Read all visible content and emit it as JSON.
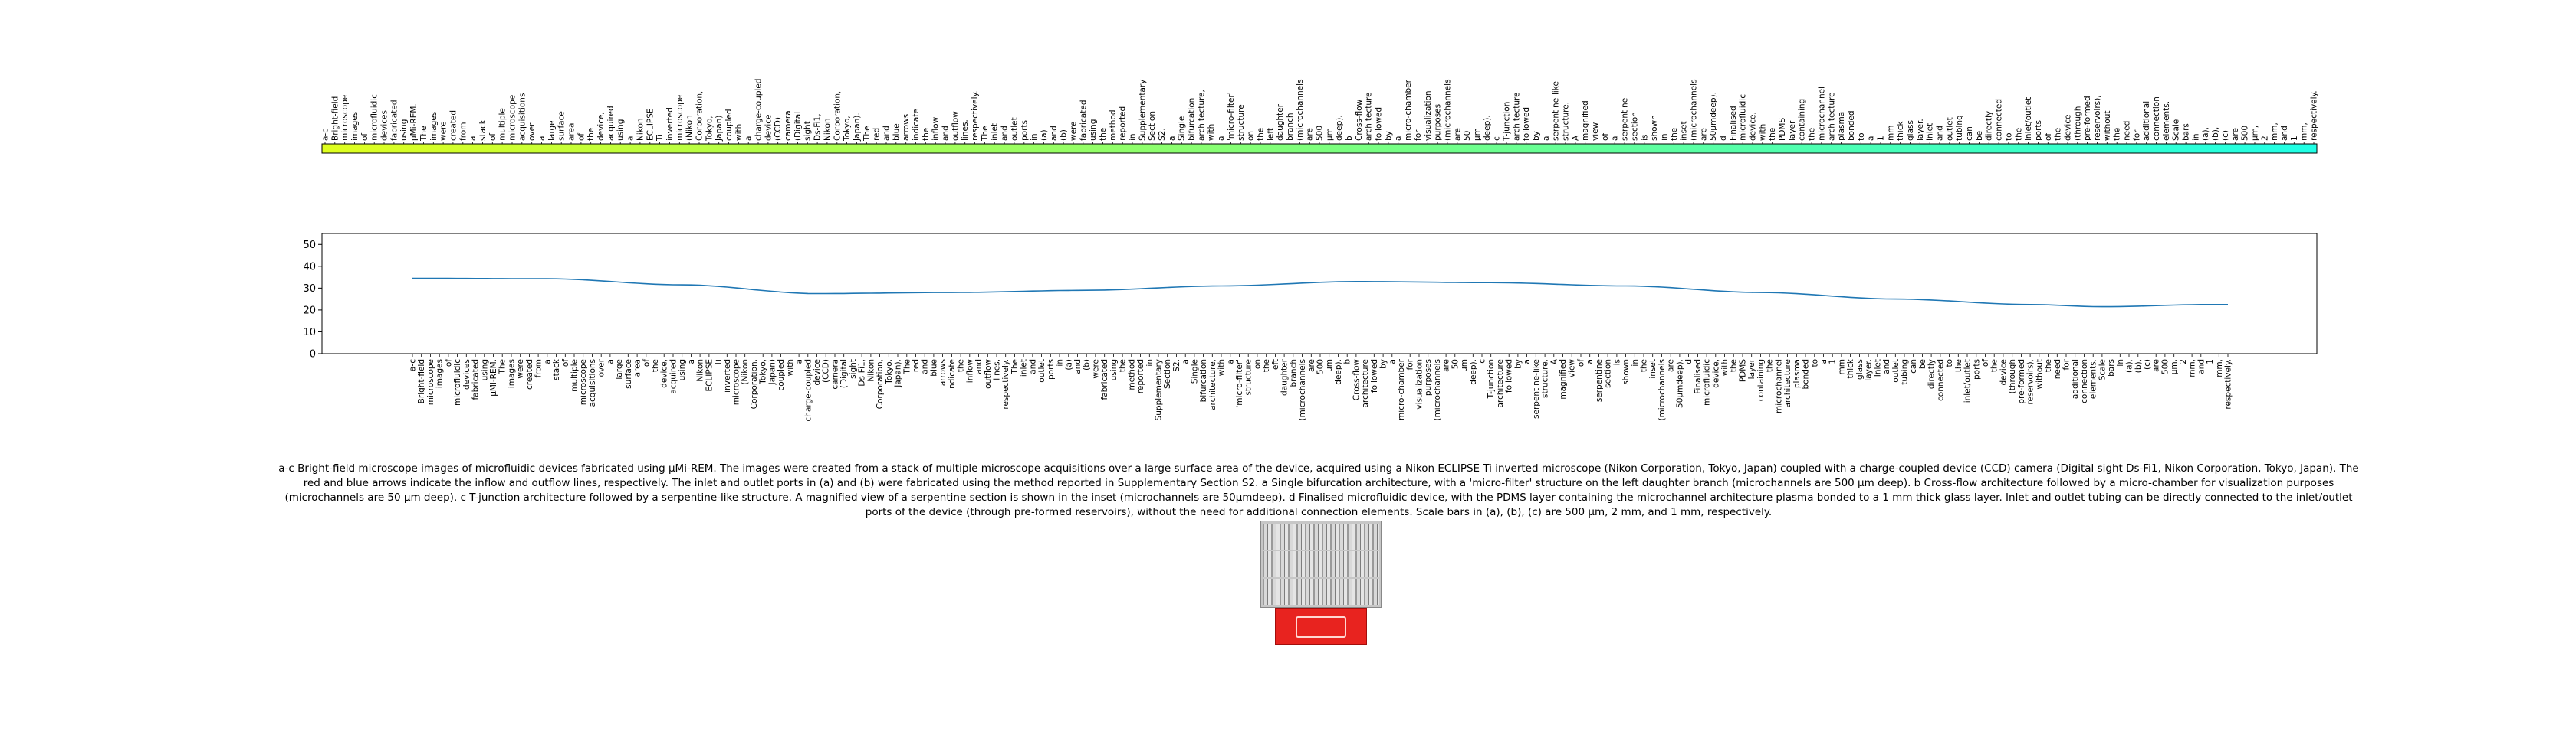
{
  "caption": "a-c Bright-field microscope images of microfluidic devices fabricated using µMi-REM. The images were created from a stack of multiple microscope acquisitions over a large surface area of the device, acquired using a Nikon ECLIPSE Ti inverted microscope (Nikon Corporation, Tokyo, Japan) coupled with a charge-coupled device (CCD) camera (Digital sight Ds-Fi1, Nikon Corporation, Tokyo, Japan). The red and blue arrows indicate the inflow and outflow lines, respectively. The inlet and outlet ports in (a) and (b) were fabricated using the method reported in Supplementary Section S2. a Single bifurcation architecture, with a 'micro-filter' structure on the left daughter branch (microchannels are 500 µm deep). b Cross-flow architecture followed by a micro-chamber for visualization purposes (microchannels are 50 µm deep). c T-junction architecture followed by a serpentine-like structure. A magnified view of a serpentine section is shown in the inset (microchannels are 50µmdeep). d Finalised microfluidic device, with the PDMS layer containing the microchannel architecture plasma bonded to a 1 mm thick glass layer. Inlet and outlet tubing can be directly connected to the inlet/outlet ports of the device (through pre-formed reservoirs), without the need for additional connection elements. Scale bars in (a), (b), (c) are 500 µm, 2 mm, and 1 mm, respectively.",
  "chart_data": {
    "type": "line",
    "x": [
      "a-c",
      "Bright-field",
      "microscope",
      "images",
      "of",
      "microfluidic",
      "devices",
      "fabricated",
      "using",
      "µMi-REM.",
      "The",
      "images",
      "were",
      "created",
      "from",
      "a",
      "stack",
      "of",
      "multiple",
      "microscope",
      "acquisitions",
      "over",
      "a",
      "large",
      "surface",
      "area",
      "of",
      "the",
      "device,",
      "acquired",
      "using",
      "a",
      "Nikon",
      "ECLIPSE",
      "Ti",
      "inverted",
      "microscope",
      "(Nikon",
      "Corporation,",
      "Tokyo,",
      "Japan)",
      "coupled",
      "with",
      "a",
      "charge-coupled",
      "device",
      "(CCD)",
      "camera",
      "(Digital",
      "sight",
      "Ds-Fi1,",
      "Nikon",
      "Corporation,",
      "Tokyo,",
      "Japan).",
      "The",
      "red",
      "and",
      "blue",
      "arrows",
      "indicate",
      "the",
      "inflow",
      "and",
      "outflow",
      "lines,",
      "respectively.",
      "The",
      "inlet",
      "and",
      "outlet",
      "ports",
      "in",
      "(a)",
      "and",
      "(b)",
      "were",
      "fabricated",
      "using",
      "the",
      "method",
      "reported",
      "in",
      "Supplementary",
      "Section",
      "S2.",
      "a",
      "Single",
      "bifurcation",
      "architecture,",
      "with",
      "a",
      "'micro-filter'",
      "structure",
      "on",
      "the",
      "left",
      "daughter",
      "branch",
      "(microchannels",
      "are",
      "500",
      "µm",
      "deep).",
      "b",
      "Cross-flow",
      "architecture",
      "followed",
      "by",
      "a",
      "micro-chamber",
      "for",
      "visualization",
      "purposes",
      "(microchannels",
      "are",
      "50",
      "µm",
      "deep).",
      "c",
      "T-junction",
      "architecture",
      "followed",
      "by",
      "a",
      "serpentine-like",
      "structure.",
      "A",
      "magnified",
      "view",
      "of",
      "a",
      "serpentine",
      "section",
      "is",
      "shown",
      "in",
      "the",
      "inset",
      "(microchannels",
      "are",
      "50µmdeep).",
      "d",
      "Finalised",
      "microfluidic",
      "device,",
      "with",
      "the",
      "PDMS",
      "layer",
      "containing",
      "the",
      "microchannel",
      "architecture",
      "plasma",
      "bonded",
      "to",
      "a",
      "1",
      "mm",
      "thick",
      "glass",
      "layer.",
      "Inlet",
      "and",
      "outlet",
      "tubing",
      "can",
      "be",
      "directly",
      "connected",
      "to",
      "the",
      "inlet/outlet",
      "ports",
      "of",
      "the",
      "device",
      "(through",
      "pre-formed",
      "reservoirs),",
      "without",
      "the",
      "need",
      "for",
      "additional",
      "connection",
      "elements.",
      "Scale",
      "bars",
      "in",
      "(a),",
      "(b),",
      "(c)",
      "are",
      "500",
      "µm,",
      "2",
      "mm,",
      "and",
      "1",
      "mm,",
      "respectively."
    ],
    "keypoints": [
      [
        0,
        34.5
      ],
      [
        15,
        34.3
      ],
      [
        30,
        31.5
      ],
      [
        45,
        27.5
      ],
      [
        60,
        28.0
      ],
      [
        75,
        29.0
      ],
      [
        90,
        31.0
      ],
      [
        105,
        33.0
      ],
      [
        120,
        32.5
      ],
      [
        135,
        31.0
      ],
      [
        150,
        28.0
      ],
      [
        165,
        25.0
      ],
      [
        180,
        22.5
      ],
      [
        188,
        21.5
      ],
      [
        200,
        22.5
      ]
    ],
    "ylim": [
      0,
      55
    ],
    "yticks": [
      0,
      10,
      20,
      30,
      40,
      50
    ],
    "line_color": "#1f77b4",
    "colorbar": {
      "from": "#dfff1f",
      "mid": "#7dff7d",
      "to": "#1fffe6"
    }
  }
}
